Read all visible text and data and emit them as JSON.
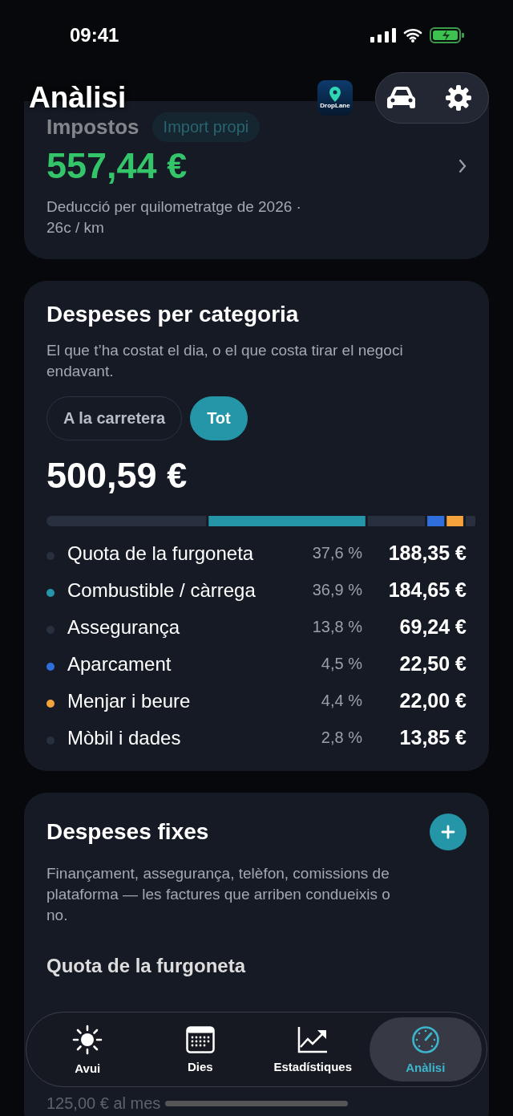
{
  "status_bar": {
    "time": "09:41"
  },
  "header": {
    "title": "Anàlisi",
    "app_badge": "DropLane"
  },
  "tax_card": {
    "title": "Impostos",
    "chip": "Import propi",
    "amount": "557,44 €",
    "note": "Deducció per quilometratge de 2026 · 26c / km"
  },
  "category_card": {
    "title": "Despeses per categoria",
    "subtitle": "El que t’ha costat el dia, o el que costa tirar el negoci endavant.",
    "filters": [
      {
        "label": "A la carretera",
        "selected": false
      },
      {
        "label": "Tot",
        "selected": true
      }
    ],
    "total": "500,59 €",
    "categories": [
      {
        "name": "Quota de la furgoneta",
        "share": "37,6 %",
        "amount": "188,35 €",
        "color": "#283040"
      },
      {
        "name": "Combustible / càrrega",
        "share": "36,9 %",
        "amount": "184,65 €",
        "color": "#2496a8"
      },
      {
        "name": "Assegurança",
        "share": "13,8 %",
        "amount": "69,24 €",
        "color": "#283040"
      },
      {
        "name": "Aparcament",
        "share": "4,5 %",
        "amount": "22,50 €",
        "color": "#2f6fdc"
      },
      {
        "name": "Menjar i beure",
        "share": "4,4 %",
        "amount": "22,00 €",
        "color": "#f4a23c"
      },
      {
        "name": "Mòbil i dades",
        "share": "2,8 %",
        "amount": "13,85 €",
        "color": "#283040"
      }
    ]
  },
  "fixed_card": {
    "title": "Despeses fixes",
    "subtitle": "Finançament, assegurança, telèfon, comissions de plataforma — les factures que arriben condueixis o no.",
    "items": [
      {
        "name": "Quota de la furgoneta",
        "detail": "125,00 € al mes"
      }
    ]
  },
  "tab_bar": [
    {
      "label": "Avui",
      "kind": "sun",
      "selected": false
    },
    {
      "label": "Dies",
      "kind": "calendar",
      "selected": false
    },
    {
      "label": "Estadístiques",
      "kind": "chart",
      "selected": false
    },
    {
      "label": "Anàlisi",
      "kind": "gauge",
      "selected": true
    }
  ]
}
